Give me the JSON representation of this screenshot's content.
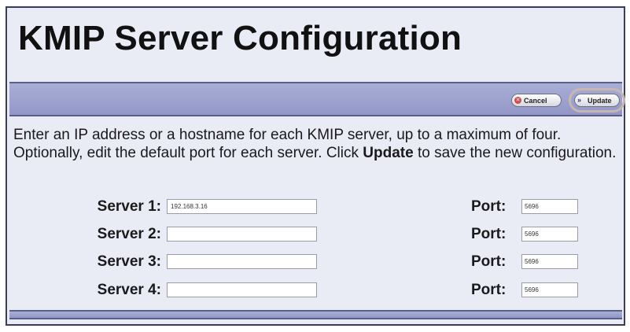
{
  "page": {
    "title": "KMIP Server Configuration"
  },
  "toolbar": {
    "cancel_label": "Cancel",
    "cancel_icon": "cancel-icon",
    "update_label": "Update",
    "update_icon": "double-chevron-right-icon"
  },
  "instructions": {
    "part1": "Enter an IP address or a hostname for each KMIP server, up to a maximum of four. Optionally, edit the default port for each server. Click ",
    "emphasis": "Update",
    "part2": " to save the new configuration."
  },
  "servers": [
    {
      "label": "Server 1:",
      "value": "192.168.3.16",
      "port_label": "Port:",
      "port": "5696"
    },
    {
      "label": "Server 2:",
      "value": "",
      "port_label": "Port:",
      "port": "5696"
    },
    {
      "label": "Server 3:",
      "value": "",
      "port_label": "Port:",
      "port": "5696"
    },
    {
      "label": "Server 4:",
      "value": "",
      "port_label": "Port:",
      "port": "5696"
    }
  ],
  "colors": {
    "panel_background": "#e9ebf5",
    "toolbar": "#9ea3cf",
    "highlight_ring": "#c9b6b0"
  }
}
